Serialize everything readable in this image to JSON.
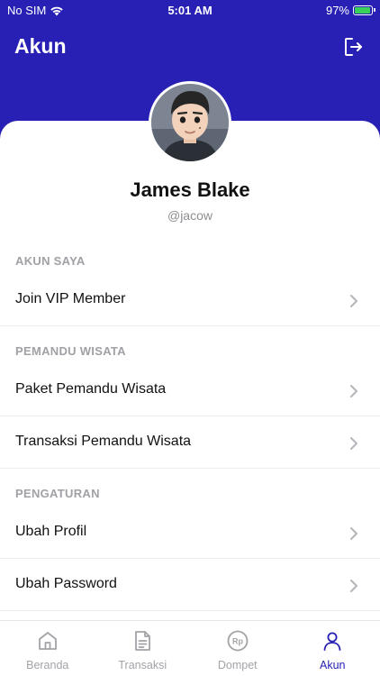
{
  "status_bar": {
    "carrier": "No SIM",
    "time": "5:01 AM",
    "battery": "97%",
    "battery_level": 0.97
  },
  "header": {
    "title": "Akun"
  },
  "profile": {
    "name": "James Blake",
    "username": "@jacow"
  },
  "sections": {
    "akun_saya": {
      "label": "AKUN SAYA",
      "items": [
        "Join VIP Member"
      ]
    },
    "pemandu_wisata": {
      "label": "PEMANDU WISATA",
      "items": [
        "Paket Pemandu Wisata",
        "Transaksi Pemandu Wisata"
      ]
    },
    "pengaturan": {
      "label": "PENGATURAN",
      "items": [
        "Ubah Profil",
        "Ubah Password"
      ]
    }
  },
  "tabbar": {
    "tabs": [
      {
        "label": "Beranda",
        "icon": "home-icon"
      },
      {
        "label": "Transaksi",
        "icon": "document-icon"
      },
      {
        "label": "Dompet",
        "icon": "rupiah-coin-icon",
        "icon_text": "Rp"
      },
      {
        "label": "Akun",
        "icon": "user-icon"
      }
    ],
    "active": "Akun"
  },
  "colors": {
    "primary": "#2820b4",
    "inactive": "#a3a3a8",
    "battery": "#3ad15b"
  }
}
